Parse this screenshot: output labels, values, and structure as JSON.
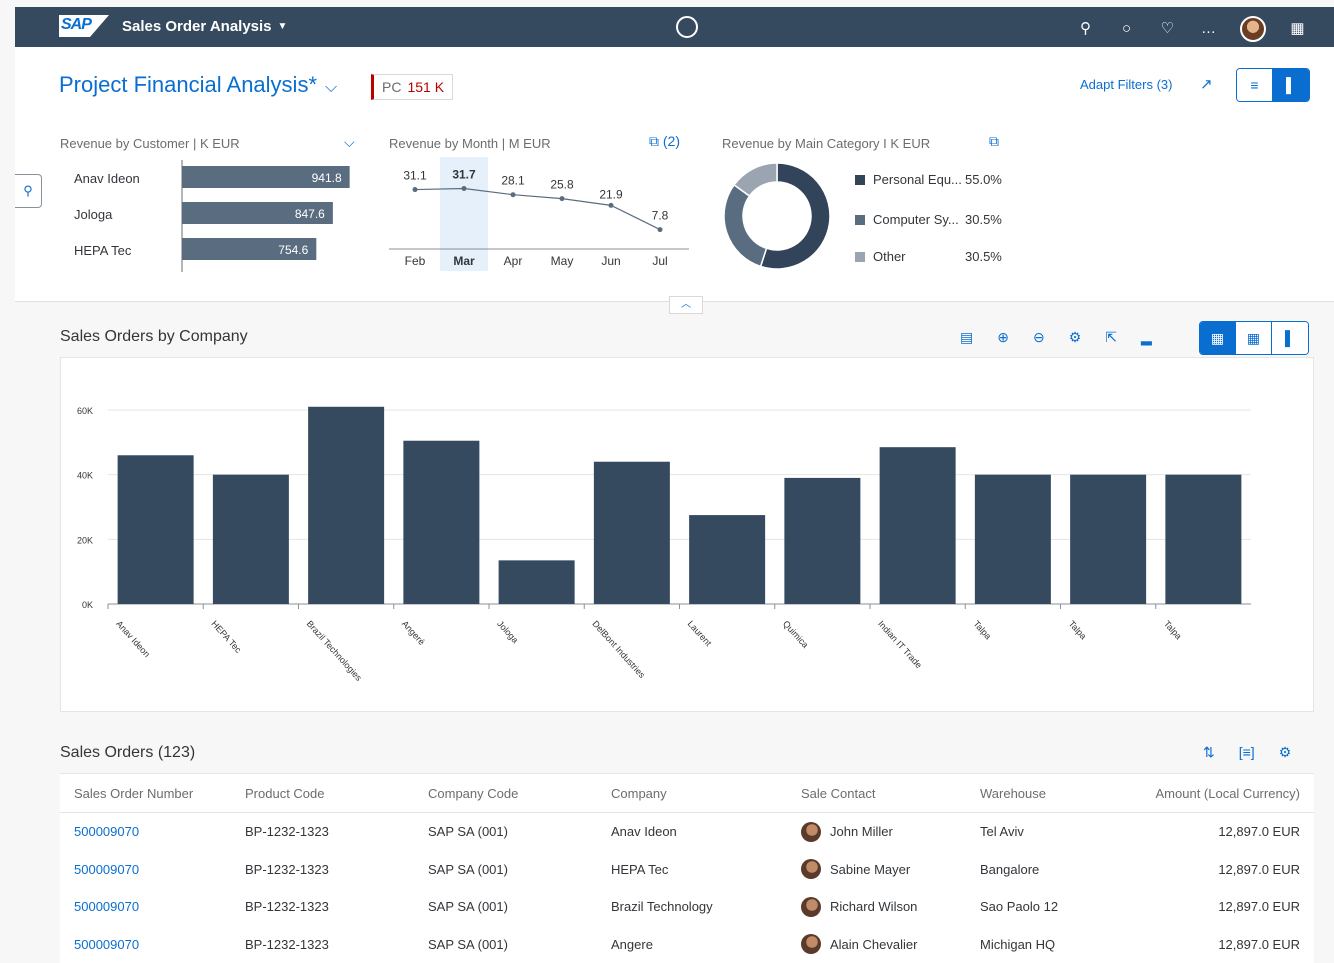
{
  "shell": {
    "logo": "SAP",
    "app_title": "Sales Order Analysis",
    "icons": [
      "search-icon",
      "circle-icon",
      "bell-icon",
      "overflow-icon",
      "avatar",
      "grid-icon"
    ]
  },
  "header": {
    "title": "Project Financial Analysis*",
    "pc_label": "PC",
    "pc_value": "151 K",
    "adapt_filters": "Adapt Filters (3)"
  },
  "kpi_customer": {
    "title": "Revenue by Customer | K EUR",
    "rows": [
      {
        "name": "Anav Ideon",
        "value": 941.8,
        "label": "941.8"
      },
      {
        "name": "Jologa",
        "value": 847.6,
        "label": "847.6"
      },
      {
        "name": "HEPA Tec",
        "value": 754.6,
        "label": "754.6"
      }
    ]
  },
  "kpi_month": {
    "title": "Revenue by Month | M EUR",
    "link": "(2)",
    "months": [
      "Feb",
      "Mar",
      "Apr",
      "May",
      "Jun",
      "Jul"
    ],
    "values": [
      31.1,
      31.7,
      28.1,
      25.8,
      21.9,
      7.8
    ],
    "labels": [
      "31.1",
      "31.7",
      "28.1",
      "25.8",
      "21.9",
      "7.8"
    ],
    "selected": "Mar"
  },
  "kpi_category": {
    "title": "Revenue by Main Category I K EUR",
    "legend": [
      {
        "name": "Personal Equ...",
        "pct": "55.0%",
        "color": "#32445a"
      },
      {
        "name": "Computer Sy...",
        "pct": "30.5%",
        "color": "#5a6d80"
      },
      {
        "name": "Other",
        "pct": "30.5%",
        "color": "#9aa5b1"
      }
    ]
  },
  "sales_chart": {
    "title": "Sales Orders by Company"
  },
  "chart_data": {
    "type": "bar",
    "categories": [
      "Anav Ideon",
      "HEPA Tec",
      "Brazil Technologies",
      "Angeré",
      "Jologa",
      "DelBont Industries",
      "Laurent",
      "Quimica",
      "Indian IT Trade",
      "Talpa",
      "Talpa",
      "Talpa"
    ],
    "values": [
      46000,
      40000,
      61000,
      50500,
      13500,
      44000,
      27500,
      39000,
      48500,
      40000,
      40000,
      40000
    ],
    "yticks": [
      "0K",
      "20K",
      "40K",
      "60K"
    ],
    "ylim": [
      0,
      60000
    ],
    "color": "#354a5f"
  },
  "table": {
    "title": "Sales Orders (123)",
    "columns": [
      "Sales Order Number",
      "Product Code",
      "Company Code",
      "Company",
      "Sale Contact",
      "Warehouse",
      "Amount (Local Currency)"
    ],
    "rows": [
      [
        "500009070",
        "BP-1232-1323",
        "SAP SA (001)",
        "Anav Ideon",
        "John Miller",
        "Tel Aviv",
        "12,897.0 EUR"
      ],
      [
        "500009070",
        "BP-1232-1323",
        "SAP SA (001)",
        "HEPA Tec",
        "Sabine Mayer",
        "Bangalore",
        "12,897.0 EUR"
      ],
      [
        "500009070",
        "BP-1232-1323",
        "SAP SA (001)",
        "Brazil Technology",
        "Richard Wilson",
        "Sao Paolo 12",
        "12,897.0 EUR"
      ],
      [
        "500009070",
        "BP-1232-1323",
        "SAP SA (001)",
        "Angere",
        "Alain Chevalier",
        "Michigan HQ",
        "12,897.0 EUR"
      ]
    ]
  }
}
